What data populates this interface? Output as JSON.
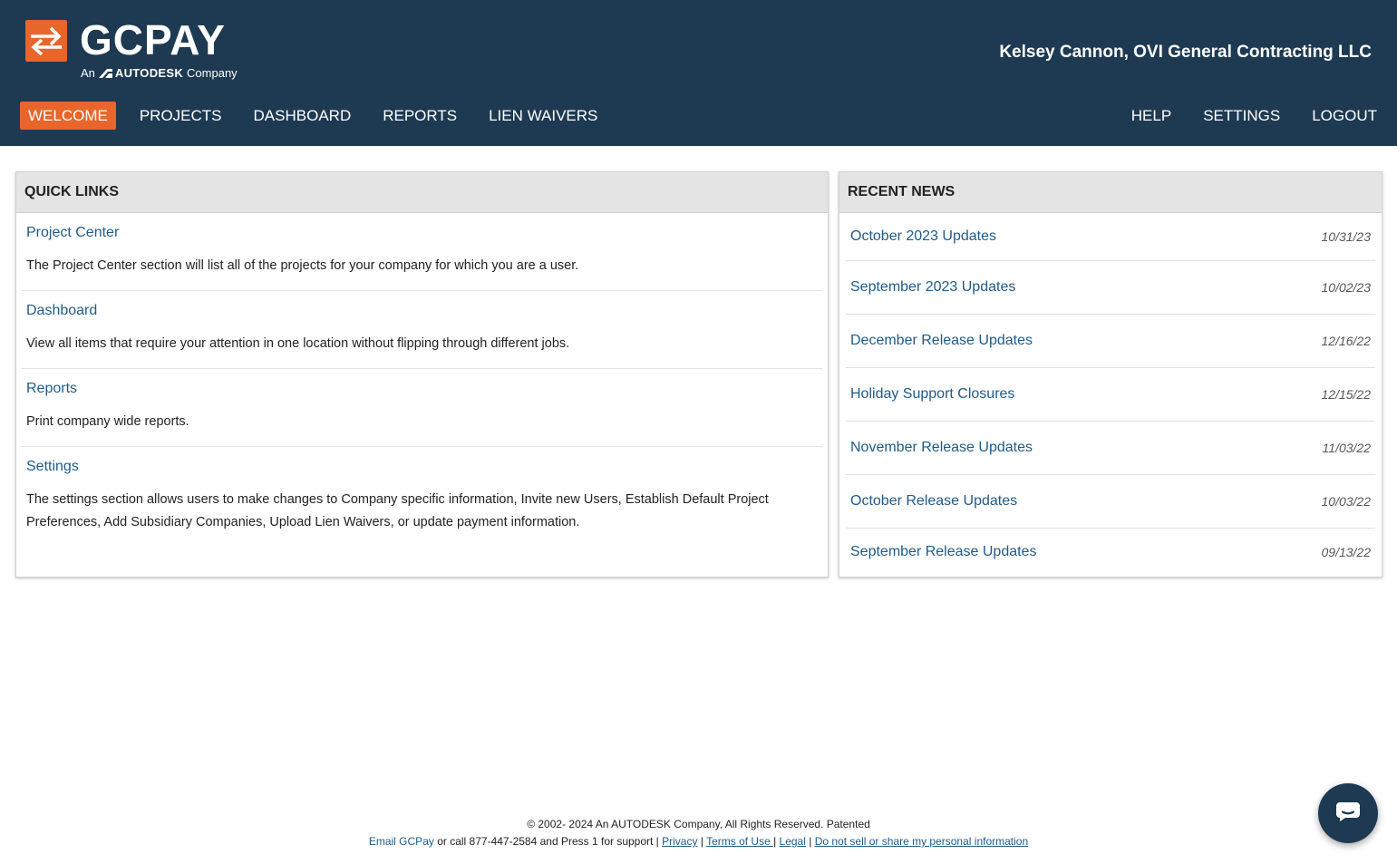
{
  "brand": {
    "name": "GCPAY",
    "tagline_prefix": "An",
    "tagline_brand": "AUTODESK",
    "tagline_suffix": "Company",
    "colors": {
      "header_bg": "#1e3a52",
      "accent": "#e8652b",
      "link": "#1f5a8a"
    }
  },
  "user": {
    "display": "Kelsey Cannon, OVI General Contracting LLC"
  },
  "nav": {
    "left": [
      {
        "label": "WELCOME",
        "active": true
      },
      {
        "label": "PROJECTS",
        "active": false
      },
      {
        "label": "DASHBOARD",
        "active": false
      },
      {
        "label": "REPORTS",
        "active": false
      },
      {
        "label": "LIEN WAIVERS",
        "active": false
      }
    ],
    "right": [
      {
        "label": "HELP"
      },
      {
        "label": "SETTINGS"
      },
      {
        "label": "LOGOUT"
      }
    ]
  },
  "quick_links": {
    "heading": "QUICK LINKS",
    "items": [
      {
        "title": "Project Center",
        "description": "The Project Center section will list all of the projects for your company for which you are a user."
      },
      {
        "title": "Dashboard",
        "description": "View all items that require your attention in one location without flipping through different jobs."
      },
      {
        "title": "Reports",
        "description": "Print company wide reports."
      },
      {
        "title": "Settings",
        "description": "The settings section allows users to make changes to Company specific information, Invite new Users, Establish Default Project Preferences, Add Subsidiary Companies, Upload Lien Waivers, or update payment information."
      }
    ]
  },
  "recent_news": {
    "heading": "RECENT NEWS",
    "items": [
      {
        "title": "October 2023 Updates",
        "date": "10/31/23"
      },
      {
        "title": "September 2023 Updates",
        "date": "10/02/23"
      },
      {
        "title": "December Release Updates",
        "date": "12/16/22"
      },
      {
        "title": "Holiday Support Closures",
        "date": "12/15/22"
      },
      {
        "title": "November Release Updates",
        "date": "11/03/22"
      },
      {
        "title": "October Release Updates",
        "date": "10/03/22"
      },
      {
        "title": "September Release Updates",
        "date": "09/13/22"
      }
    ]
  },
  "footer": {
    "copyright": "© 2002- 2024 An AUTODESK Company, All Rights Reserved. Patented",
    "email_link": "Email GCPay",
    "support_text": " or call 877-447-2584 and Press 1 for support | ",
    "privacy": "Privacy",
    "terms": "Terms of Use ",
    "legal": "Legal",
    "do_not_sell": "Do not sell or share my personal information",
    "separator": " | "
  },
  "icons": {
    "logo_mark": "exchange-arrows-icon",
    "chat": "chat-bubble-icon"
  }
}
